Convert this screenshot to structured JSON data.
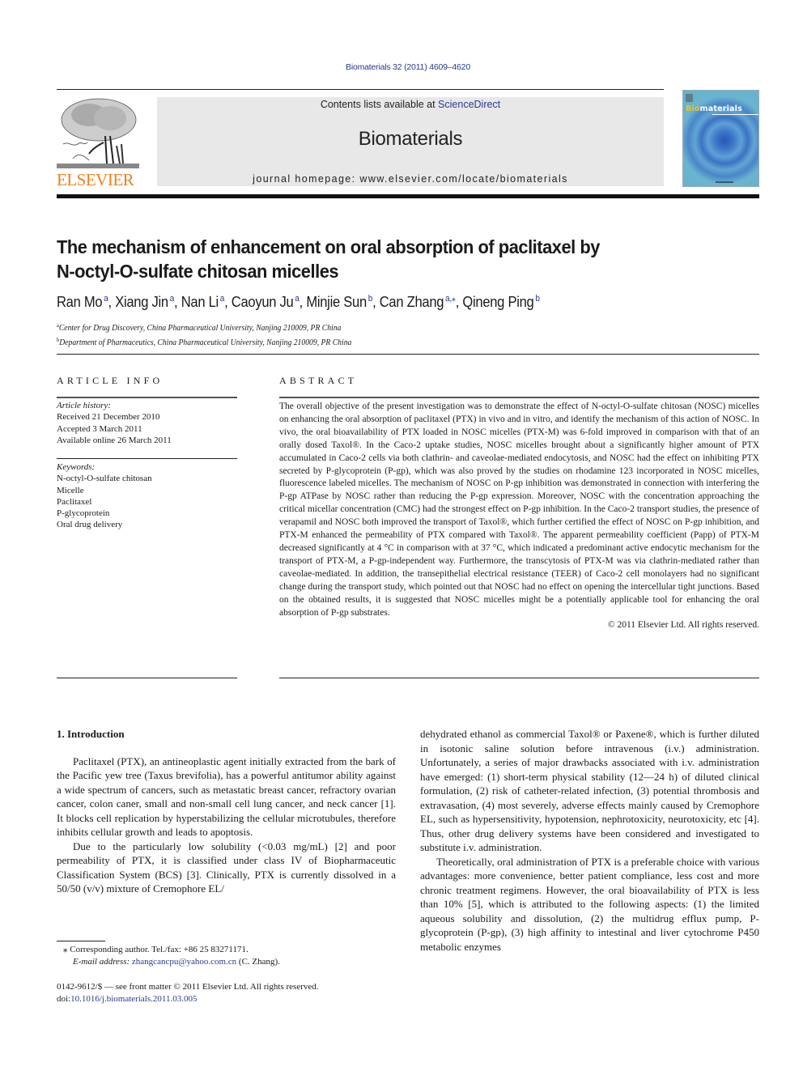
{
  "header": {
    "citation": "Biomaterials 32 (2011) 4609–4620",
    "contents_prefix": "Contents lists available at ",
    "contents_link": "ScienceDirect",
    "journal_name": "Biomaterials",
    "homepage": "journal homepage: www.elsevier.com/locate/biomaterials",
    "publisher_logo_text": "ELSEVIER",
    "cover_title_bio": "Bio",
    "cover_title_rest": "materials",
    "colors": {
      "publisher_orange": "#f0801a",
      "link_blue": "#2a3a8c",
      "masthead_gray": "#e8e8e8",
      "cover_teal": "#63b2c9"
    }
  },
  "article": {
    "title_line1": "The mechanism of enhancement on oral absorption of paclitaxel by",
    "title_line2": "N-octyl-O-sulfate chitosan micelles",
    "authors": [
      {
        "name": "Ran Mo",
        "aff": "a"
      },
      {
        "name": "Xiang Jin",
        "aff": "a"
      },
      {
        "name": "Nan Li",
        "aff": "a"
      },
      {
        "name": "Caoyun Ju",
        "aff": "a"
      },
      {
        "name": "Minjie Sun",
        "aff": "b"
      },
      {
        "name": "Can Zhang",
        "aff": "a,⁎"
      },
      {
        "name": "Qineng Ping",
        "aff": "b"
      }
    ],
    "affiliations": [
      {
        "mark": "a",
        "text": "Center for Drug Discovery, China Pharmaceutical University, Nanjing 210009, PR China"
      },
      {
        "mark": "b",
        "text": "Department of Pharmaceutics, China Pharmaceutical University, Nanjing 210009, PR China"
      }
    ]
  },
  "article_info": {
    "heading": "ARTICLE INFO",
    "history_label": "Article history:",
    "history": [
      "Received 21 December 2010",
      "Accepted 3 March 2011",
      "Available online 26 March 2011"
    ],
    "keywords_label": "Keywords:",
    "keywords": [
      "N-octyl-O-sulfate chitosan",
      "Micelle",
      "Paclitaxel",
      "P-glycoprotein",
      "Oral drug delivery"
    ]
  },
  "abstract": {
    "heading": "ABSTRACT",
    "text": "The overall objective of the present investigation was to demonstrate the effect of N-octyl-O-sulfate chitosan (NOSC) micelles on enhancing the oral absorption of paclitaxel (PTX) in vivo and in vitro, and identify the mechanism of this action of NOSC. In vivo, the oral bioavailability of PTX loaded in NOSC micelles (PTX-M) was 6-fold improved in comparison with that of an orally dosed Taxol®. In the Caco-2 uptake studies, NOSC micelles brought about a significantly higher amount of PTX accumulated in Caco-2 cells via both clathrin- and caveolae-mediated endocytosis, and NOSC had the effect on inhibiting PTX secreted by P-glycoprotein (P-gp), which was also proved by the studies on rhodamine 123 incorporated in NOSC micelles, fluorescence labeled micelles. The mechanism of NOSC on P-gp inhibition was demonstrated in connection with interfering the P-gp ATPase by NOSC rather than reducing the P-gp expression. Moreover, NOSC with the concentration approaching the critical micellar concentration (CMC) had the strongest effect on P-gp inhibition. In the Caco-2 transport studies, the presence of verapamil and NOSC both improved the transport of Taxol®, which further certified the effect of NOSC on P-gp inhibition, and PTX-M enhanced the permeability of PTX compared with Taxol®. The apparent permeability coefficient (Papp) of PTX-M decreased significantly at 4 °C in comparison with at 37 °C, which indicated a predominant active endocytic mechanism for the transport of PTX-M, a P-gp-independent way. Furthermore, the transcytosis of PTX-M was via clathrin-mediated rather than caveolae-mediated. In addition, the transepithelial electrical resistance (TEER) of Caco-2 cell monolayers had no significant change during the transport study, which pointed out that NOSC had no effect on opening the intercellular tight junctions. Based on the obtained results, it is suggested that NOSC micelles might be a potentially applicable tool for enhancing the oral absorption of P-gp substrates.",
    "copyright": "© 2011 Elsevier Ltd. All rights reserved."
  },
  "body": {
    "section_heading": "1.  Introduction",
    "left_paragraphs": [
      "Paclitaxel (PTX), an antineoplastic agent initially extracted from the bark of the Pacific yew tree (Taxus brevifolia), has a powerful antitumor ability against a wide spectrum of cancers, such as metastatic breast cancer, refractory ovarian cancer, colon caner, small and non-small cell lung cancer, and neck cancer [1]. It blocks cell replication by hyperstabilizing the cellular microtubules, therefore inhibits cellular growth and leads to apoptosis.",
      "Due to the particularly low solubility (<0.03 mg/mL) [2] and poor permeability of PTX, it is classified under class IV of Biopharmaceutic Classification System (BCS) [3]. Clinically, PTX is currently dissolved in a 50/50 (v/v) mixture of Cremophore EL/"
    ],
    "right_paragraphs": [
      "dehydrated ethanol as commercial Taxol® or Paxene®, which is further diluted in isotonic saline solution before intravenous (i.v.) administration. Unfortunately, a series of major drawbacks associated with i.v. administration have emerged: (1) short-term physical stability (12—24 h) of diluted clinical formulation, (2) risk of catheter-related infection, (3) potential thrombosis and extravasation, (4) most severely, adverse effects mainly caused by Cremophore EL, such as hypersensitivity, hypotension, nephrotoxicity, neurotoxicity, etc [4]. Thus, other drug delivery systems have been considered and investigated to substitute i.v. administration.",
      "Theoretically, oral administration of PTX is a preferable choice with various advantages: more convenience, better patient compliance, less cost and more chronic treatment regimens. However, the oral bioavailability of PTX is less than 10% [5], which is attributed to the following aspects: (1) the limited aqueous solubility and dissolution, (2) the multidrug efflux pump, P-glycoprotein (P-gp), (3) high affinity to intestinal and liver cytochrome P450 metabolic enzymes"
    ]
  },
  "footnotes": {
    "corresponding": "⁎  Corresponding author. Tel./fax: +86 25 83271171.",
    "email_label": "E-mail address: ",
    "email": "zhangcancpu@yahoo.com.cn",
    "email_suffix": " (C. Zhang).",
    "front_matter": "0142-9612/$ — see front matter © 2011 Elsevier Ltd. All rights reserved.",
    "doi_label": "doi:",
    "doi": "10.1016/j.biomaterials.2011.03.005"
  }
}
